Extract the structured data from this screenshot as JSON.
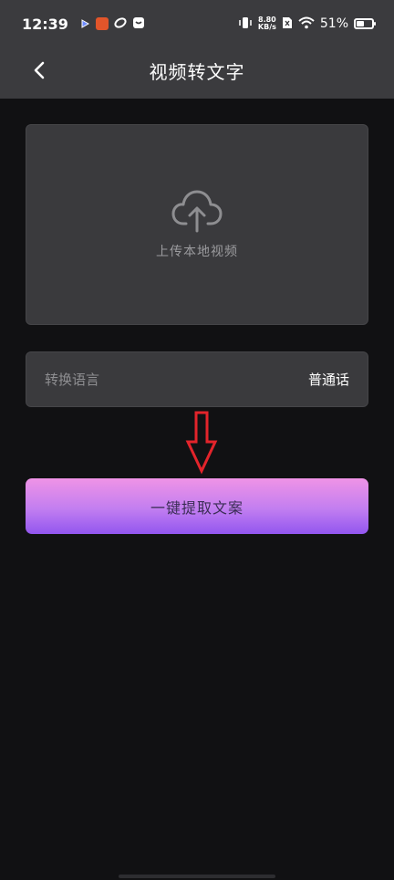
{
  "status_bar": {
    "time": "12:39",
    "net_speed_value": "8.80",
    "net_speed_unit": "KB/s",
    "battery_text": "51%",
    "battery_level": 0.51
  },
  "nav": {
    "title": "视频转文字",
    "back_icon": "chevron-left-icon"
  },
  "upload": {
    "icon": "cloud-upload-icon",
    "label": "上传本地视频"
  },
  "language": {
    "label": "转换语言",
    "value": "普通话"
  },
  "extract": {
    "label": "一键提取文案"
  },
  "colors": {
    "background": "#111113",
    "header": "#3b3b3e",
    "card": "#3a3a3d",
    "arrow": "#e3242b",
    "button_top": "#ef93e6",
    "button_bottom": "#9256ef"
  }
}
